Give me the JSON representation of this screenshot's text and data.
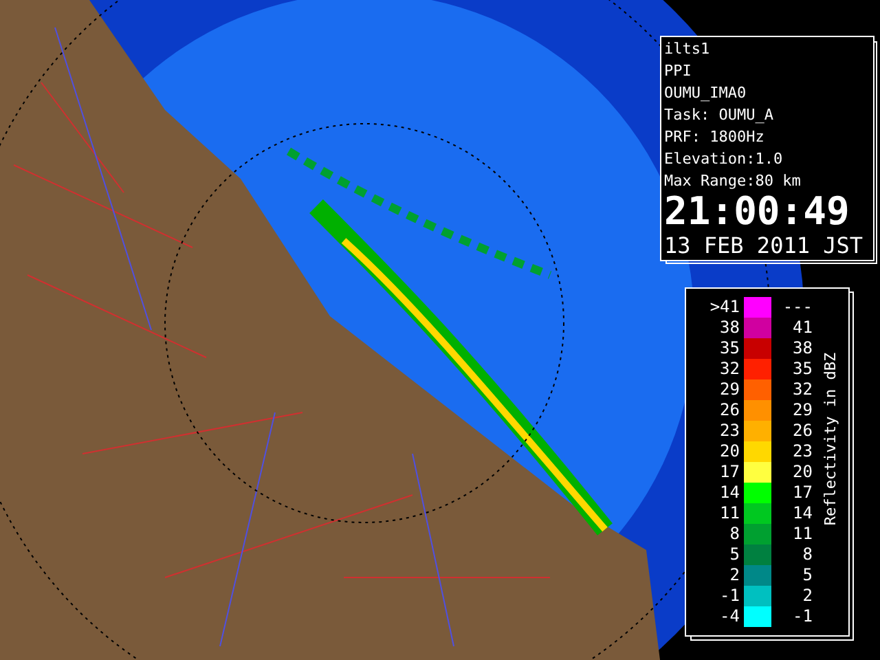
{
  "info_panel": {
    "lines": [
      "ilts1",
      "PPI",
      "OUMU_IMA0",
      "Task: OUMU_A",
      "PRF: 1800Hz",
      "Elevation:1.0",
      "Max Range:80 km"
    ],
    "time": "21:00:49",
    "date": "13 FEB 2011 JST"
  },
  "legend": {
    "title": "Reflectivity in dBZ",
    "rows": [
      {
        "low": ">41",
        "high": "---",
        "color": "#ff00ff"
      },
      {
        "low": "38",
        "high": "41",
        "color": "#d000a0"
      },
      {
        "low": "35",
        "high": "38",
        "color": "#c80000"
      },
      {
        "low": "32",
        "high": "35",
        "color": "#ff2000"
      },
      {
        "low": "29",
        "high": "32",
        "color": "#ff6000"
      },
      {
        "low": "26",
        "high": "29",
        "color": "#ff9000"
      },
      {
        "low": "23",
        "high": "26",
        "color": "#ffb000"
      },
      {
        "low": "20",
        "high": "23",
        "color": "#ffd800"
      },
      {
        "low": "17",
        "high": "20",
        "color": "#ffff40"
      },
      {
        "low": "14",
        "high": "17",
        "color": "#00ff00"
      },
      {
        "low": "11",
        "high": "14",
        "color": "#00c820"
      },
      {
        "low": "8",
        "high": "11",
        "color": "#00a030"
      },
      {
        "low": "5",
        "high": "8",
        "color": "#008040"
      },
      {
        "low": "2",
        "high": "5",
        "color": "#008888"
      },
      {
        "low": "-1",
        "high": "2",
        "color": "#00c0c0"
      },
      {
        "low": "-4",
        "high": "-1",
        "color": "#00ffff"
      }
    ]
  }
}
